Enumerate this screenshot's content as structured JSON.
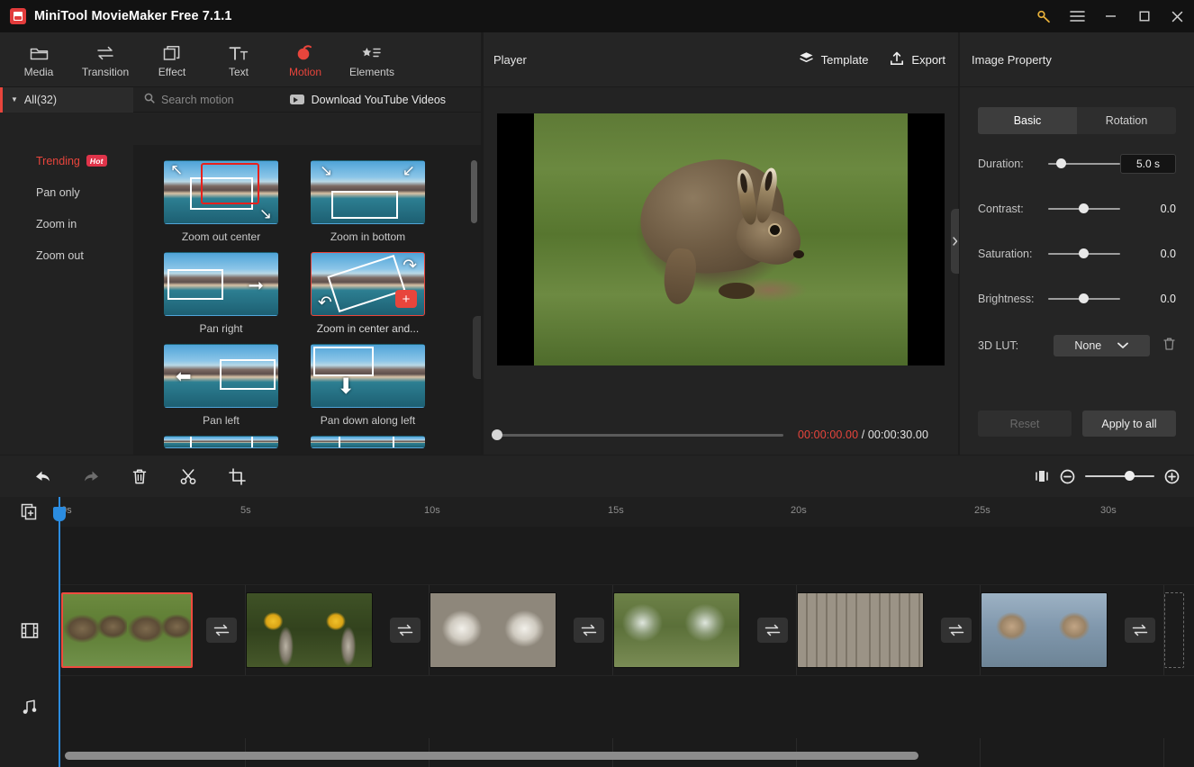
{
  "window": {
    "title": "MiniTool MovieMaker Free 7.1.1",
    "controls": {
      "key": "key-icon",
      "menu": "hamburger-menu-icon",
      "minimize": "minimize-icon",
      "maximize": "maximize-icon",
      "close": "close-icon"
    }
  },
  "ribbon": {
    "items": [
      {
        "label": "Media",
        "icon": "folder-icon",
        "active": false
      },
      {
        "label": "Transition",
        "icon": "transition-icon",
        "active": false
      },
      {
        "label": "Effect",
        "icon": "effect-icon",
        "active": false
      },
      {
        "label": "Text",
        "icon": "text-icon",
        "active": false
      },
      {
        "label": "Motion",
        "icon": "motion-icon",
        "active": true
      },
      {
        "label": "Elements",
        "icon": "elements-icon",
        "active": false
      }
    ],
    "active_accent": "#e8453c"
  },
  "library": {
    "all_label": "All(32)",
    "search_placeholder": "Search motion",
    "download_label": "Download YouTube Videos",
    "categories": [
      {
        "label": "Trending",
        "badge": "Hot",
        "active": true
      },
      {
        "label": "Pan only",
        "badge": "",
        "active": false
      },
      {
        "label": "Zoom in",
        "badge": "",
        "active": false
      },
      {
        "label": "Zoom out",
        "badge": "",
        "active": false
      }
    ],
    "motions": [
      {
        "label": "Zoom out center",
        "selected": false
      },
      {
        "label": "Zoom in bottom",
        "selected": false
      },
      {
        "label": "Pan right",
        "selected": false
      },
      {
        "label": "Zoom in center and...",
        "selected": true
      },
      {
        "label": "Pan left",
        "selected": false
      },
      {
        "label": "Pan down along left",
        "selected": false
      }
    ],
    "add_button_label": "+"
  },
  "player": {
    "title": "Player",
    "template_label": "Template",
    "export_label": "Export",
    "current_time": "00:00:00.00",
    "separator": " / ",
    "total_time": "00:00:30.00",
    "aspect_ratio": "16:9",
    "controls": [
      {
        "name": "play-button",
        "icon": "play-icon"
      },
      {
        "name": "previous-button",
        "icon": "previous-frame-icon"
      },
      {
        "name": "next-button",
        "icon": "next-frame-icon"
      },
      {
        "name": "stop-button",
        "icon": "stop-icon"
      },
      {
        "name": "volume-button",
        "icon": "volume-icon"
      }
    ],
    "fullscreen": "fullscreen-icon",
    "preview_subject": "brown hare on grass"
  },
  "properties": {
    "title": "Image Property",
    "tabs": [
      {
        "label": "Basic",
        "active": true
      },
      {
        "label": "Rotation",
        "active": false
      }
    ],
    "rows": [
      {
        "label": "Duration:",
        "value": "5.0 s",
        "boxed": true,
        "knob": 14
      },
      {
        "label": "Contrast:",
        "value": "0.0",
        "boxed": false,
        "knob": 50
      },
      {
        "label": "Saturation:",
        "value": "0.0",
        "boxed": false,
        "knob": 50
      },
      {
        "label": "Brightness:",
        "value": "0.0",
        "boxed": false,
        "knob": 50
      }
    ],
    "lut_label": "3D LUT:",
    "lut_value": "None",
    "delete_lut": "trash-icon",
    "reset_label": "Reset",
    "apply_label": "Apply to all"
  },
  "timeline": {
    "tools": [
      {
        "name": "undo-button",
        "icon": "undo-icon",
        "dim": false
      },
      {
        "name": "redo-button",
        "icon": "redo-icon",
        "dim": true
      },
      {
        "name": "delete-button",
        "icon": "trash-icon",
        "dim": false
      },
      {
        "name": "split-button",
        "icon": "scissors-icon",
        "dim": false
      },
      {
        "name": "crop-button",
        "icon": "crop-icon",
        "dim": false
      }
    ],
    "zoom_fit": "fit-timeline-icon",
    "zoom_out": "zoom-out-icon",
    "zoom_in": "zoom-in-icon",
    "ticks": [
      "0s",
      "5s",
      "10s",
      "15s",
      "20s",
      "25s",
      "30s"
    ],
    "add_media": "add-media-icon",
    "video_track_icon": "film-strip-icon",
    "audio_track_icon": "music-note-icon",
    "clips": [
      {
        "name": "clip-hare",
        "pic": "pic-hare",
        "selected": true
      },
      {
        "name": "clip-bird",
        "pic": "pic-bird",
        "selected": false
      },
      {
        "name": "clip-dog",
        "pic": "pic-dog",
        "selected": false
      },
      {
        "name": "clip-spiderweb",
        "pic": "pic-web",
        "selected": false
      },
      {
        "name": "clip-feeder",
        "pic": "pic-feeder",
        "selected": false
      },
      {
        "name": "clip-squirrel",
        "pic": "pic-squirrel",
        "selected": false
      }
    ],
    "transition_icon": "transition-swap-icon"
  }
}
